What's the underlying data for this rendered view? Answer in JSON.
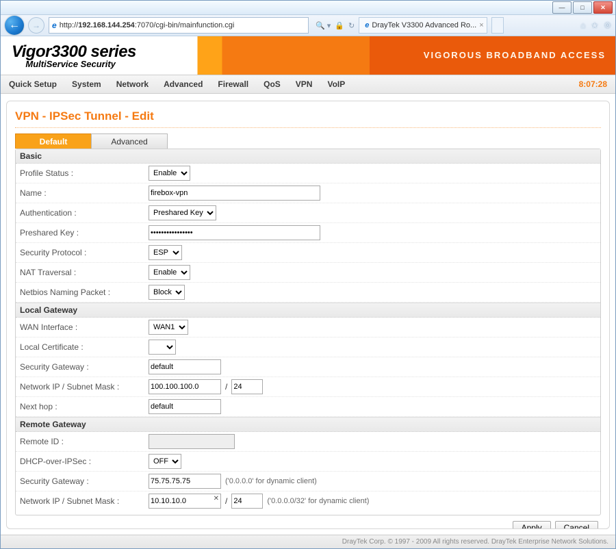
{
  "window": {
    "url_prefix": "http://",
    "url_host": "192.168.144.254",
    "url_path": ":7070/cgi-bin/mainfunction.cgi",
    "tab_title": "DrayTek V3300 Advanced Ro..."
  },
  "brand": {
    "line1": "Vigor3300 series",
    "line2": "MultiService Security",
    "tagline": "VIGOROUS BROADBAND ACCESS"
  },
  "menu": {
    "items": [
      "Quick Setup",
      "System",
      "Network",
      "Advanced",
      "Firewall",
      "QoS",
      "VPN",
      "VoIP"
    ],
    "clock": "8:07:28"
  },
  "page_title": "VPN - IPSec Tunnel - Edit",
  "tabs": {
    "default": "Default",
    "advanced": "Advanced"
  },
  "sections": {
    "basic": {
      "title": "Basic",
      "profile_status": {
        "label": "Profile Status :",
        "value": "Enable"
      },
      "name": {
        "label": "Name :",
        "value": "firebox-vpn"
      },
      "auth": {
        "label": "Authentication :",
        "value": "Preshared Key"
      },
      "psk": {
        "label": "Preshared Key :",
        "value": "••••••••••••••••"
      },
      "sec_proto": {
        "label": "Security Protocol :",
        "value": "ESP"
      },
      "nat_trav": {
        "label": "NAT Traversal :",
        "value": "Enable"
      },
      "netbios": {
        "label": "Netbios Naming Packet :",
        "value": "Block"
      }
    },
    "local": {
      "title": "Local Gateway",
      "wan_if": {
        "label": "WAN Interface :",
        "value": "WAN1"
      },
      "local_cert": {
        "label": "Local Certificate :",
        "value": ""
      },
      "sec_gw": {
        "label": "Security Gateway :",
        "value": "default"
      },
      "net_ip": {
        "label": "Network IP / Subnet Mask :",
        "ip": "100.100.100.0",
        "mask": "24",
        "slash": "/"
      },
      "next_hop": {
        "label": "Next hop :",
        "value": "default"
      }
    },
    "remote": {
      "title": "Remote Gateway",
      "remote_id": {
        "label": "Remote ID :",
        "value": ""
      },
      "dhcp_ipsec": {
        "label": "DHCP-over-IPSec :",
        "value": "OFF"
      },
      "sec_gw": {
        "label": "Security Gateway :",
        "value": "75.75.75.75",
        "hint": "('0.0.0.0' for dynamic client)"
      },
      "net_ip": {
        "label": "Network IP / Subnet Mask :",
        "ip": "10.10.10.0",
        "mask": "24",
        "slash": "/",
        "hint": "('0.0.0.0/32' for dynamic client)"
      }
    }
  },
  "buttons": {
    "apply": "Apply",
    "cancel": "Cancel"
  },
  "footer": "DrayTek Corp. © 1997 - 2009 All rights reserved. DrayTek Enterprise Network Solutions."
}
